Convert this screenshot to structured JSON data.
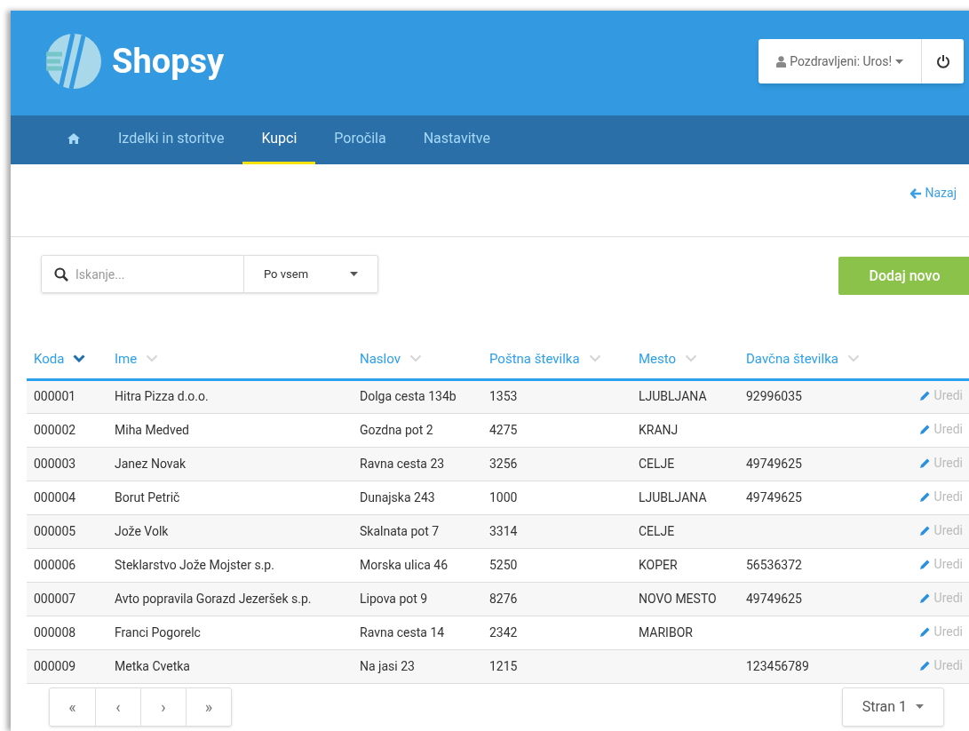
{
  "header": {
    "logo_text": "Shopsy",
    "user_menu": "Pozdravljeni: Uros!"
  },
  "nav": [
    {
      "kind": "home",
      "selected": false
    },
    {
      "kind": "link",
      "label": "Izdelki in storitve",
      "selected": false
    },
    {
      "kind": "link",
      "label": "Kupci",
      "selected": true
    },
    {
      "kind": "link",
      "label": "Poročila",
      "selected": false
    },
    {
      "kind": "link",
      "label": "Nastavitve",
      "selected": false
    }
  ],
  "back_link": "Nazaj",
  "search": {
    "placeholder": "Iskanje...",
    "filter": "Po vsem"
  },
  "add_button": "Dodaj novo",
  "table": {
    "columns": [
      {
        "label": "Koda",
        "sorted": true
      },
      {
        "label": "Ime",
        "sorted": false
      },
      {
        "label": "Naslov",
        "sorted": false
      },
      {
        "label": "Poštna številka",
        "sorted": false
      },
      {
        "label": "Mesto",
        "sorted": false
      },
      {
        "label": "Davčna številka",
        "sorted": false
      }
    ],
    "rows": [
      {
        "cells": [
          "000001",
          "Hitra Pizza d.o.o.",
          "Dolga cesta 134b",
          "1353",
          "LJUBLJANA",
          "92996035"
        ],
        "action": "Uredi"
      },
      {
        "cells": [
          "000002",
          "Miha Medved",
          "Gozdna pot 2",
          "4275",
          "KRANJ",
          ""
        ],
        "action": "Uredi"
      },
      {
        "cells": [
          "000003",
          "Janez Novak",
          "Ravna cesta 23",
          "3256",
          "CELJE",
          "49749625"
        ],
        "action": "Uredi"
      },
      {
        "cells": [
          "000004",
          "Borut Petrič",
          "Dunajska 243",
          "1000",
          "LJUBLJANA",
          "49749625"
        ],
        "action": "Uredi"
      },
      {
        "cells": [
          "000005",
          "Jože Volk",
          "Skalnata pot 7",
          "3314",
          "CELJE",
          ""
        ],
        "action": "Uredi"
      },
      {
        "cells": [
          "000006",
          "Steklarstvo Jože Mojster s.p.",
          "Morska ulica 46",
          "5250",
          "KOPER",
          "56536372"
        ],
        "action": "Uredi"
      },
      {
        "cells": [
          "000007",
          "Avto popravila Gorazd Jezeršek s.p.",
          "Lipova pot 9",
          "8276",
          "NOVO MESTO",
          "49749625"
        ],
        "action": "Uredi"
      },
      {
        "cells": [
          "000008",
          "Franci Pogorelc",
          "Ravna cesta 14",
          "2342",
          "MARIBOR",
          ""
        ],
        "action": "Uredi"
      },
      {
        "cells": [
          "000009",
          "Metka Cvetka",
          "Na jasi 23",
          "1215",
          "",
          "123456789"
        ],
        "action": "Uredi"
      }
    ]
  },
  "pagination": {
    "buttons": [
      "«",
      "‹",
      "›",
      "»"
    ],
    "page": "Stran 1"
  }
}
